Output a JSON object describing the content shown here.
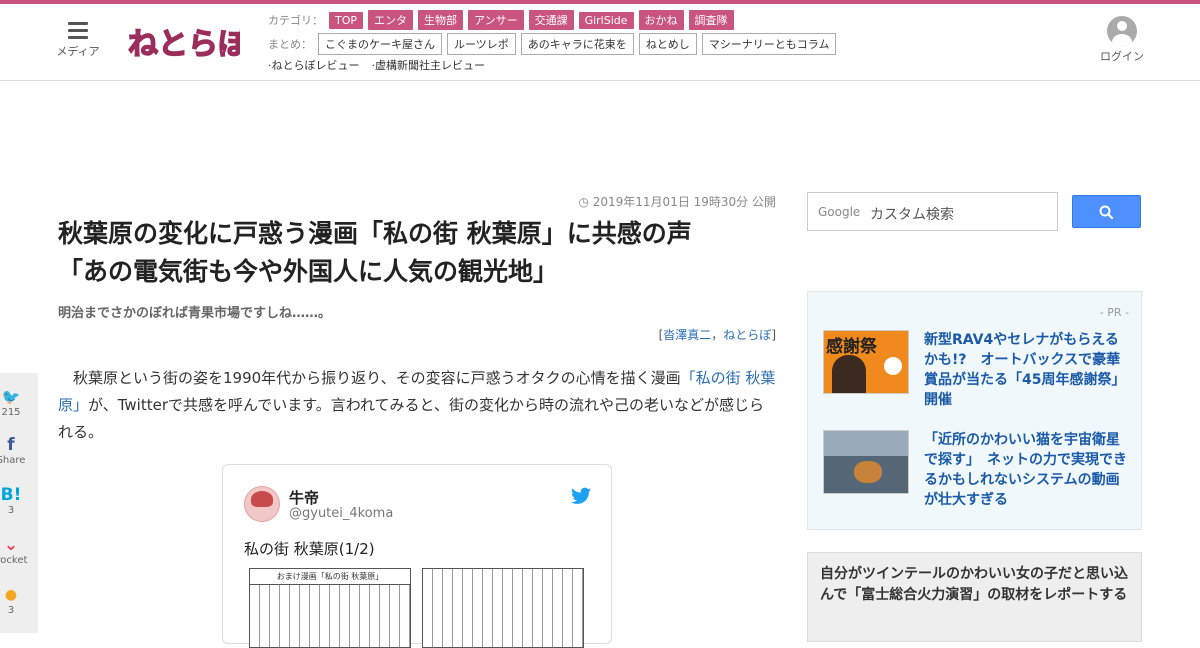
{
  "header": {
    "menu_label": "メディア",
    "logo_text": "ねとらぼ",
    "category_label": "カテゴリ：",
    "categories": [
      "TOP",
      "エンタ",
      "生物部",
      "アンサー",
      "交通課",
      "GirlSide",
      "おかね",
      "調査隊"
    ],
    "summary_label": "まとめ：",
    "summaries": [
      "こぐまのケーキ屋さん",
      "ルーツレポ",
      "あのキャラに花束を",
      "ねとめし",
      "マシーナリーともコラム"
    ],
    "reviews": [
      "·ねとらぼレビュー",
      "·虚構新聞社主レビュー"
    ],
    "login_label": "ログイン"
  },
  "article": {
    "pubdate": "2019年11月01日 19時30分 公開",
    "title_line1": "秋葉原の変化に戸惑う漫画「私の街 秋葉原」に共感の声",
    "title_line2": "「あの電気街も今や外国人に人気の観光地」",
    "subtitle": "明治までさかのぼれば青果市場ですしね……。",
    "byline_open": "[",
    "byline_author": "沓澤真二",
    "byline_sep": "，",
    "byline_media": "ねとらぼ",
    "byline_close": "]",
    "lead_1": "秋葉原という街の姿を1990年代から振り返り、その変容に戸惑うオタクの心情を描く漫画",
    "lead_link": "「私の街 秋葉原」",
    "lead_2": "が、Twitterで共感を呼んでいます。言われてみると、街の変化から時の流れや己の老いなどが感じられる。"
  },
  "tweet": {
    "name": "牛帝",
    "handle": "@gyutei_4koma",
    "text": "私の街 秋葉原(1/2)",
    "manga_header": "おまけ漫画「私の街 秋葉原」"
  },
  "share": [
    {
      "icon": "twitter-icon",
      "glyph": "🐦",
      "count": "215"
    },
    {
      "icon": "facebook-icon",
      "glyph": "f",
      "count": "Share"
    },
    {
      "icon": "hatena-icon",
      "glyph": "B!",
      "count": "3"
    },
    {
      "icon": "pocket-icon",
      "glyph": "⌄",
      "count": "Pocket"
    },
    {
      "icon": "comment-icon",
      "glyph": "●",
      "count": "3"
    }
  ],
  "sidebar": {
    "search_google": "Google",
    "search_placeholder": "カスタム検索",
    "pr_label": "- PR -",
    "pr_items": [
      {
        "text": "新型RAV4やセレナがもらえるかも!?　オートバックスで豪華賞品が当たる「45周年感謝祭」開催",
        "thumb_text": "感謝祭"
      },
      {
        "text": "「近所のかわいい猫を宇宙衛星で探す」　ネットの力で実現できるかもしれないシステムの動画が壮大すぎる",
        "thumb_text": ""
      }
    ],
    "ranking_text": "自分がツインテールのかわいい女の子だと思い込んで「富士総合火力演習」の取材をレポートする"
  },
  "colors": {
    "accent": "#c8547f",
    "link": "#2a6db5",
    "pr_link": "#1a5aa8",
    "search_button": "#4d90fe"
  }
}
